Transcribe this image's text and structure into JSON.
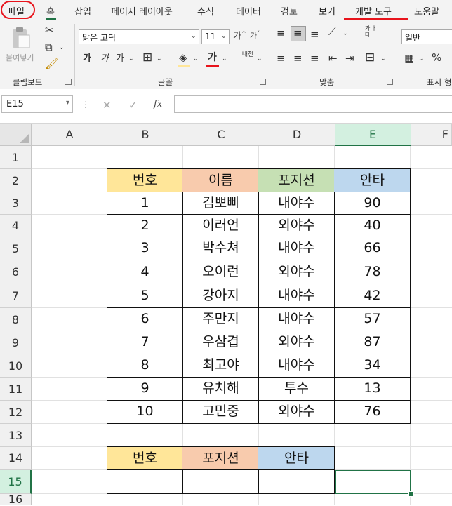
{
  "menu": {
    "items": [
      "파일",
      "홈",
      "삽입",
      "페이지 레이아웃",
      "수식",
      "데이터",
      "검토",
      "보기",
      "개발 도구",
      "도움말"
    ]
  },
  "ribbon": {
    "clipboard": {
      "label": "클립보드",
      "paste_label": "붙여넣기"
    },
    "font": {
      "label": "글꼴",
      "font_name": "맑은 고딕",
      "font_size": "11",
      "bold": "가",
      "italic": "가",
      "underline": "가",
      "font_color_glyph": "가",
      "grow": "가",
      "shrink": "가",
      "phonetic": "내천"
    },
    "alignment": {
      "label": "맞춤",
      "wrap": "가나다"
    },
    "number": {
      "label": "표시 형",
      "format": "일반"
    }
  },
  "formula_bar": {
    "name_box": "E15",
    "fx": "fx",
    "value": ""
  },
  "columns": [
    "A",
    "B",
    "C",
    "D",
    "E",
    "F"
  ],
  "rows": [
    "1",
    "2",
    "3",
    "4",
    "5",
    "6",
    "7",
    "8",
    "9",
    "10",
    "11",
    "12",
    "13",
    "14",
    "15",
    "16"
  ],
  "active_cell": "E15",
  "table": {
    "headers": [
      "번호",
      "이름",
      "포지션",
      "안타"
    ],
    "rows": [
      [
        "1",
        "김뽀삐",
        "내야수",
        "90"
      ],
      [
        "2",
        "이러언",
        "외야수",
        "40"
      ],
      [
        "3",
        "박수쳐",
        "내야수",
        "66"
      ],
      [
        "4",
        "오이런",
        "외야수",
        "78"
      ],
      [
        "5",
        "강아지",
        "내야수",
        "42"
      ],
      [
        "6",
        "주만지",
        "내야수",
        "57"
      ],
      [
        "7",
        "우삼겹",
        "외야수",
        "87"
      ],
      [
        "8",
        "최고야",
        "내야수",
        "34"
      ],
      [
        "9",
        "유치해",
        "투수",
        "13"
      ],
      [
        "10",
        "고민중",
        "외야수",
        "76"
      ]
    ]
  },
  "lookup": {
    "headers": [
      "번호",
      "포지션",
      "안타"
    ]
  },
  "colors": {
    "accent_green": "#217346",
    "annotation_red": "#e8141c",
    "hdr_yellow": "#ffe699",
    "hdr_orange": "#f8cbad",
    "hdr_green": "#c6e0b4",
    "hdr_blue": "#bdd7ee"
  }
}
